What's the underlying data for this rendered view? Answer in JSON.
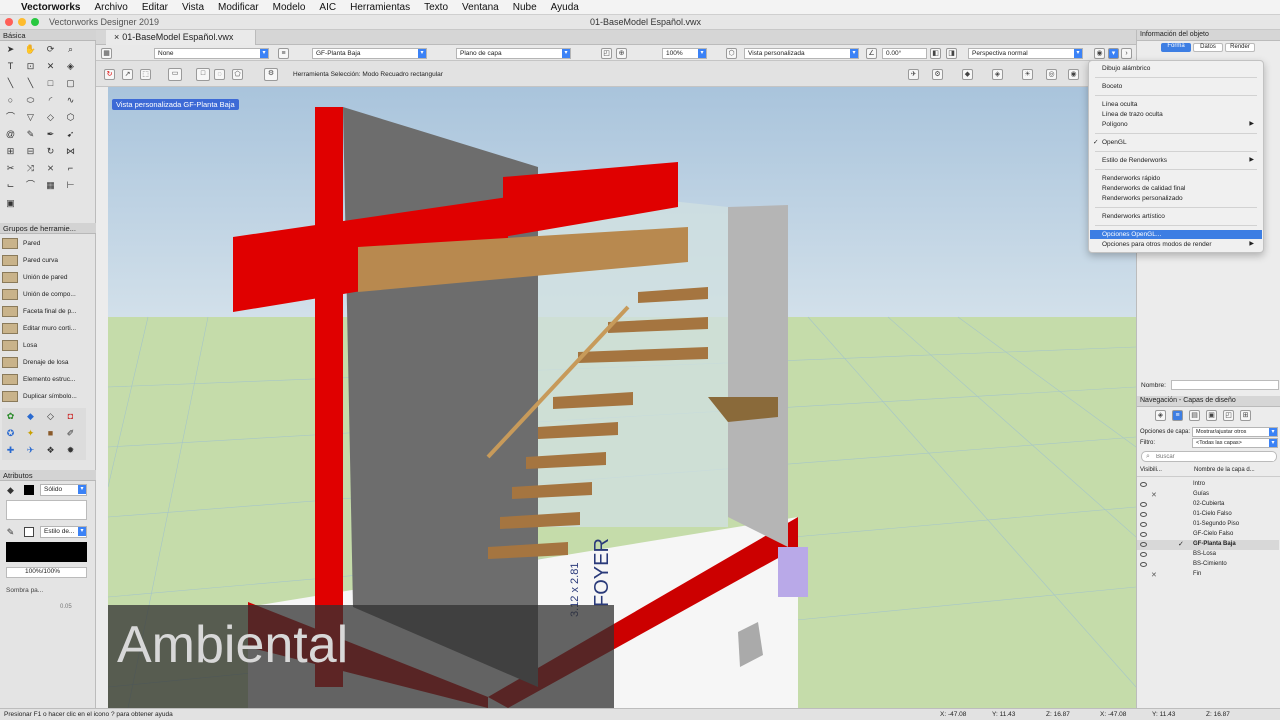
{
  "menubar": {
    "apple": "",
    "app": "Vectorworks",
    "items": [
      "Archivo",
      "Editar",
      "Vista",
      "Modificar",
      "Modelo",
      "AIC",
      "Herramientas",
      "Texto",
      "Ventana",
      "Nube",
      "Ayuda"
    ]
  },
  "window": {
    "app_title": "Vectorworks Designer 2019",
    "doc_title": "01-BaseModel Español.vwx",
    "tab": "01-BaseModel Español.vwx"
  },
  "viewbar": {
    "class": "None",
    "layer": "GF-Planta Baja",
    "layer_plane": "Plano de capa",
    "zoom": "100%",
    "view": "Vista personalizada",
    "angle": "0.00°",
    "projection": "Perspectiva normal"
  },
  "modebar": {
    "hint": "Herramienta Selección: Modo Recuadro rectangular"
  },
  "viewport": {
    "label": "Vista personalizada  GF-Planta Baja",
    "floor_text": "FOYER",
    "floor_dims": "3.12 x 2.81",
    "overlay_text": "sión Ambiental"
  },
  "left": {
    "basic_title": "Básica",
    "groups_title": "Grupos de herramie...",
    "tools": [
      "Pared",
      "Pared curva",
      "Unión de pared",
      "Unión de compo...",
      "Faceta final de p...",
      "Editar muro corti...",
      "Losa",
      "Drenaje de losa",
      "Elemento estruc...",
      "Duplicar símbolo..."
    ],
    "attrs_title": "Atributos",
    "fill": "Sólido",
    "line": "Estilo de...",
    "opacity": "100%/100%",
    "shadow": "Sombra pa...",
    "shadow_val": "0.05"
  },
  "right": {
    "obj_title": "Información del objeto",
    "tabs": [
      "Forma",
      "Datos",
      "Render"
    ],
    "name_label": "Nombre:",
    "nav_title": "Navegación - Capas de diseño",
    "layer_opts_label": "Opciones de capa:",
    "layer_opts_val": "Mostrar/ajustar otros",
    "filter_label": "Filtro:",
    "filter_val": "<Todas las capas>",
    "search_placeholder": "Buscar",
    "col_vis": "Visibili...",
    "col_name": "Nombre de la capa d...",
    "layers": [
      {
        "name": "Intro",
        "vis": "eye",
        "active": false
      },
      {
        "name": "Guías",
        "vis": "x",
        "active": false
      },
      {
        "name": "02-Cubierta",
        "vis": "eye",
        "active": false
      },
      {
        "name": "01-Cielo Falso",
        "vis": "eye",
        "active": false
      },
      {
        "name": "01-Segundo Piso",
        "vis": "eye",
        "active": false
      },
      {
        "name": "GF-Cielo Falso",
        "vis": "eye",
        "active": false
      },
      {
        "name": "GF-Planta Baja",
        "vis": "eye",
        "active": true
      },
      {
        "name": "BS-Losa",
        "vis": "eye",
        "active": false
      },
      {
        "name": "BS-Cimiento",
        "vis": "eye",
        "active": false
      },
      {
        "name": "Fin",
        "vis": "x",
        "active": false
      }
    ]
  },
  "context_menu": [
    {
      "label": "Dibujo alámbrico"
    },
    {
      "sep": true
    },
    {
      "label": "Boceto"
    },
    {
      "sep": true
    },
    {
      "label": "Línea oculta"
    },
    {
      "label": "Línea de trazo oculta"
    },
    {
      "label": "Polígono",
      "sub": true
    },
    {
      "sep": true
    },
    {
      "label": "OpenGL",
      "checked": true
    },
    {
      "sep": true
    },
    {
      "label": "Estilo de Renderworks",
      "sub": true
    },
    {
      "sep": true
    },
    {
      "label": "Renderworks rápido"
    },
    {
      "label": "Renderworks de calidad final"
    },
    {
      "label": "Renderworks personalizado"
    },
    {
      "sep": true
    },
    {
      "label": "Renderworks artístico"
    },
    {
      "sep": true
    },
    {
      "label": "Opciones OpenGL...",
      "highlight": true
    },
    {
      "label": "Opciones para otros modos de render",
      "sub": true
    }
  ],
  "status": {
    "help": "Presionar F1 o hacer clic en el icono ? para obtener ayuda",
    "x": "X: -47.08",
    "y": "Y: 11.43",
    "z": "Z: 16.87",
    "x2": "X: -47.08",
    "y2": "Y: 11.43",
    "z2": "Z: 16.87"
  },
  "colors": {
    "accent": "#3d7ee3",
    "red": "#e00000",
    "wood": "#b8894f",
    "sky": "#bcd2e4",
    "ground": "#c5dcaa"
  }
}
